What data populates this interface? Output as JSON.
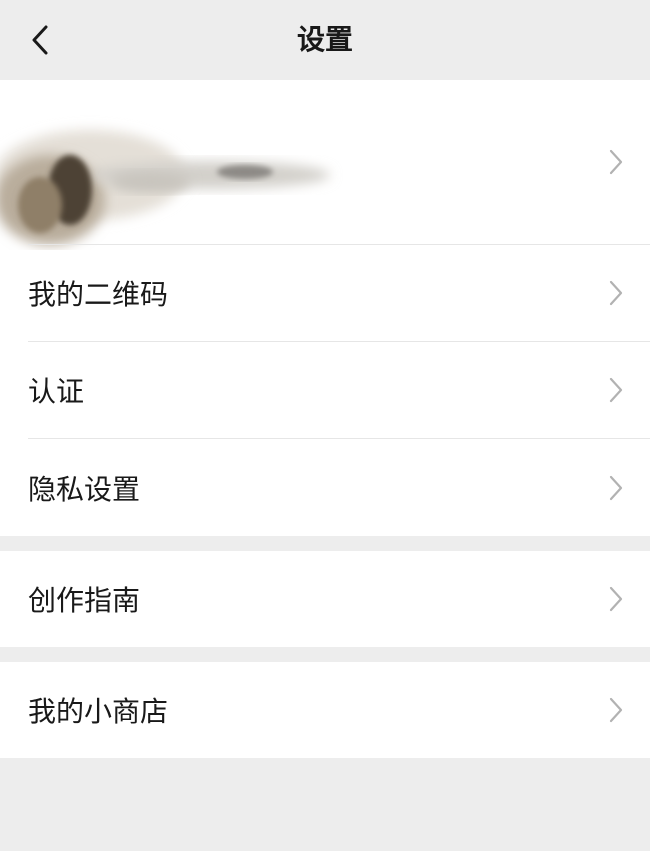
{
  "header": {
    "title": "设置",
    "back_icon": "chevron-left-icon"
  },
  "profile": {
    "avatar_icon": "avatar-blurred",
    "chevron_icon": "chevron-right-icon"
  },
  "groups": [
    {
      "items": [
        {
          "label": "我的二维码"
        },
        {
          "label": "认证"
        },
        {
          "label": "隐私设置"
        }
      ]
    },
    {
      "items": [
        {
          "label": "创作指南"
        }
      ]
    },
    {
      "items": [
        {
          "label": "我的小商店"
        }
      ]
    }
  ],
  "colors": {
    "background": "#ededed",
    "card": "#ffffff",
    "text": "#191919",
    "chevron": "#b2b2b2",
    "divider": "#e6e6e6"
  }
}
